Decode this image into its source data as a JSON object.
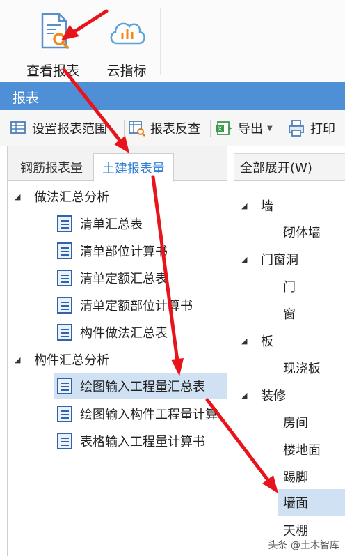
{
  "ribbon": {
    "view_report": "查看报表",
    "cloud_indicator": "云指标"
  },
  "titlebar": {
    "title": "报表"
  },
  "toolbar": {
    "settings": "设置报表范围",
    "review": "报表反查",
    "export": "导出",
    "print": "打印"
  },
  "left_panel": {
    "tabs": [
      "钢筋报表量",
      "土建报表量"
    ],
    "active_tab": "土建报表量",
    "groups": [
      {
        "label": "做法汇总分析",
        "items": [
          "清单汇总表",
          "清单部位计算书",
          "清单定额汇总表",
          "清单定额部位计算书",
          "构件做法汇总表"
        ]
      },
      {
        "label": "构件汇总分析",
        "items": [
          "绘图输入工程量汇总表",
          "绘图输入构件工程量计算",
          "表格输入工程量计算书"
        ]
      }
    ],
    "selected_item": "绘图输入工程量汇总表"
  },
  "right_panel": {
    "expand_all": "全部展开(W)",
    "rows": [
      {
        "label": "墙",
        "level": 0
      },
      {
        "label": "砌体墙",
        "level": 1
      },
      {
        "label": "门窗洞",
        "level": 0
      },
      {
        "label": "门",
        "level": 1
      },
      {
        "label": "窗",
        "level": 1
      },
      {
        "label": "板",
        "level": 0
      },
      {
        "label": "现浇板",
        "level": 1
      },
      {
        "label": "装修",
        "level": 0
      },
      {
        "label": "房间",
        "level": 1
      },
      {
        "label": "楼地面",
        "level": 1
      },
      {
        "label": "踢脚",
        "level": 1
      },
      {
        "label": "墙面",
        "level": 1
      },
      {
        "label": "天棚",
        "level": 1
      }
    ],
    "selected_row": "墙面"
  },
  "watermark": "头条 @土木智库",
  "colors": {
    "accent": "#4f8fd6",
    "selection": "#cfe1f3",
    "annotation_arrow": "#e8141b"
  }
}
